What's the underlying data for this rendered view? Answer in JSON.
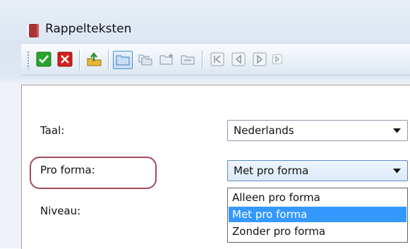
{
  "window": {
    "title": "Rappelteksten"
  },
  "toolbar": {
    "buttons": [
      {
        "icon": "check-icon",
        "color": "#2aa52a"
      },
      {
        "icon": "close-icon",
        "color": "#d21f1f"
      },
      {
        "icon": "export-icon",
        "color": "#e0a21a"
      },
      {
        "icon": "folder-icon",
        "color": "#4a90d9"
      },
      {
        "icon": "copy-icon"
      },
      {
        "icon": "folder-new-icon"
      },
      {
        "icon": "folder-edit-icon"
      },
      {
        "icon": "first-record-icon"
      },
      {
        "icon": "prev-record-icon"
      },
      {
        "icon": "next-record-icon"
      },
      {
        "icon": "last-record-icon"
      }
    ]
  },
  "form": {
    "taal_label": "Taal:",
    "taal_value": "Nederlands",
    "proforma_label": "Pro forma:",
    "proforma_value": "Met pro forma",
    "niveau_label": "Niveau:",
    "proforma_options": [
      "Alleen pro forma",
      "Met pro forma",
      "Zonder pro forma"
    ],
    "proforma_selected_index": 1
  },
  "colors": {
    "highlight_oval": "#a24b5c",
    "selection": "#3399ff"
  }
}
